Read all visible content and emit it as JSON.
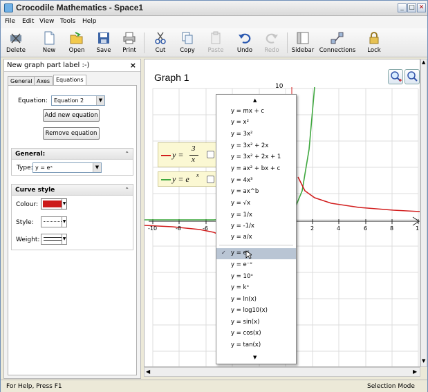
{
  "window": {
    "title": "Crocodile Mathematics - Space1"
  },
  "menu": [
    "File",
    "Edit",
    "View",
    "Tools",
    "Help"
  ],
  "toolbar": {
    "items": [
      {
        "label": "Delete",
        "enabled": true
      },
      {
        "label": "New",
        "enabled": true
      },
      {
        "label": "Open",
        "enabled": true
      },
      {
        "label": "Save",
        "enabled": true
      },
      {
        "label": "Print",
        "enabled": true
      },
      {
        "label": "Cut",
        "enabled": true
      },
      {
        "label": "Copy",
        "enabled": true
      },
      {
        "label": "Paste",
        "enabled": false
      },
      {
        "label": "Undo",
        "enabled": true
      },
      {
        "label": "Redo",
        "enabled": false
      },
      {
        "label": "Sidebar",
        "enabled": true
      },
      {
        "label": "Connections",
        "enabled": true
      },
      {
        "label": "Lock",
        "enabled": true
      }
    ]
  },
  "panel": {
    "title": "New graph part label :-)",
    "close": "×",
    "tabs": [
      "General",
      "Axes",
      "Equations"
    ],
    "active_tab": "Equations",
    "equation_label": "Equation:",
    "equation_value": "Equation 2",
    "add_button": "Add new equation",
    "remove_button": "Remove equation",
    "general_header": "General:",
    "type_label": "Type:",
    "type_value": "y = eˣ",
    "curve_header": "Curve style",
    "colour_label": "Colour:",
    "colour_value": "#cc1a1a",
    "style_label": "Style:",
    "weight_label": "Weight:"
  },
  "graph": {
    "title": "Graph 1",
    "y_top_label": "10",
    "x_ticks_left": [
      "-10",
      "-8",
      "-6"
    ],
    "x_ticks_right": [
      "2",
      "4",
      "6",
      "8",
      "1"
    ],
    "legend": [
      {
        "lhs": "y =",
        "num": "3",
        "den": "x",
        "color": "#d21e1e"
      },
      {
        "lhs": "y = e",
        "sup": "x",
        "color": "#3fa83f"
      }
    ]
  },
  "dropdown": {
    "items": [
      "y = mx + c",
      "y = x²",
      "y = 3x²",
      "y = 3x² + 2x",
      "y = 3x² + 2x + 1",
      "y = ax² + bx + c",
      "y = 4x³",
      "y = ax^b",
      "y = √x",
      "y = 1/x",
      "y = -1/x",
      "y = a/x",
      "y = eˣ",
      "y = e⁻ˣ",
      "y = 10ˣ",
      "y = kˣ",
      "y = ln(x)",
      "y = log10(x)",
      "y = sin(x)",
      "y = cos(x)",
      "y = tan(x)"
    ],
    "selected": "y = eˣ",
    "check": "✓"
  },
  "status": {
    "left": "For Help, Press F1",
    "right": "Selection Mode"
  }
}
